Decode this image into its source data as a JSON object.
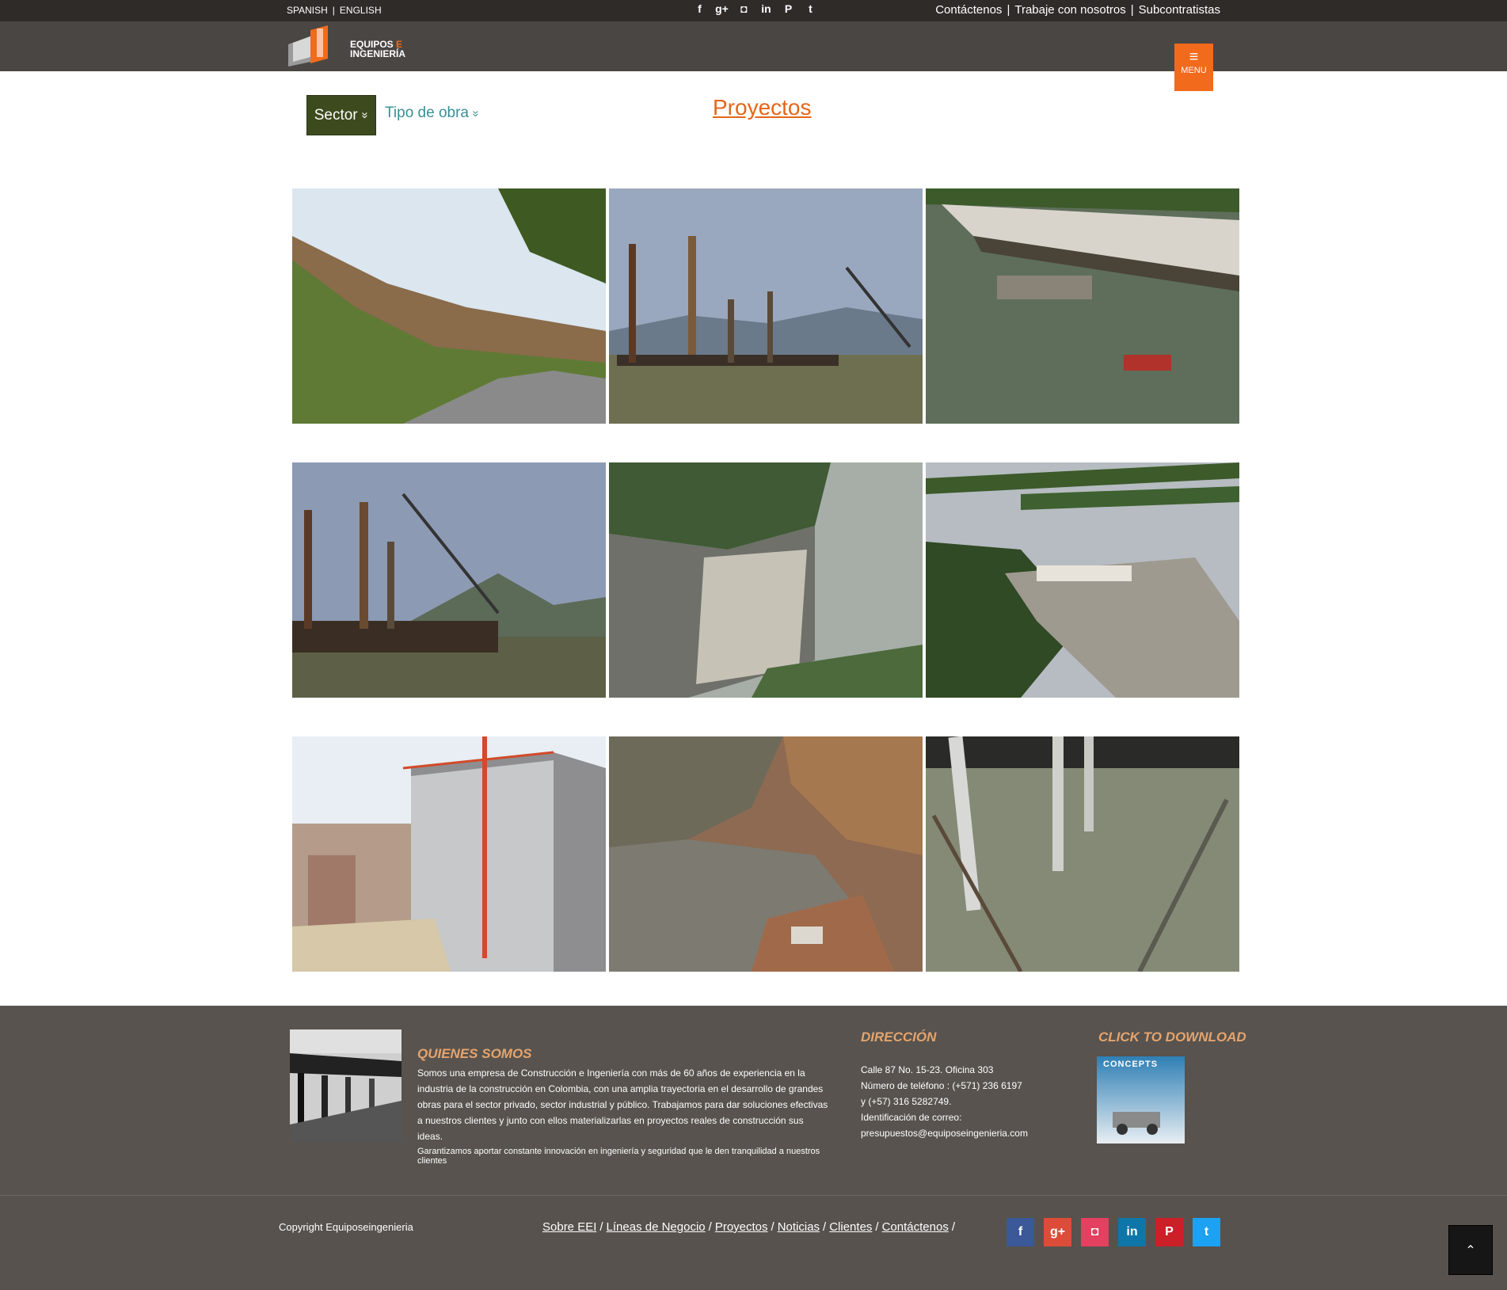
{
  "topbar": {
    "lang_es": "SPANISH",
    "lang_sep": "|",
    "lang_en": "ENGLISH",
    "social": [
      "facebook-icon",
      "google-plus-icon",
      "instagram-icon",
      "linkedin-icon",
      "pinterest-icon",
      "twitter-icon"
    ],
    "social_glyphs": [
      "f",
      "g+",
      "◘",
      "in",
      "P",
      "t"
    ],
    "links": [
      "Contáctenos",
      "Trabaje con nosotros",
      "Subcontratistas"
    ],
    "link_sep": "|"
  },
  "header": {
    "logo_line1": "EQUIPOS",
    "logo_e": "E",
    "logo_line2": "INGENIERÍA",
    "menu_icon": "≡",
    "menu_label": "MENU"
  },
  "filters": {
    "sector": "Sector",
    "tipo": "Tipo de obra",
    "chevron": "»"
  },
  "page_title": "Proyectos",
  "gallery": [
    {
      "name": "highway-hillside"
    },
    {
      "name": "pile-driving-barge"
    },
    {
      "name": "pier-aerial"
    },
    {
      "name": "pier-cranes"
    },
    {
      "name": "aerial-site-river"
    },
    {
      "name": "aerial-port-construction"
    },
    {
      "name": "highrise-construction"
    },
    {
      "name": "rock-slope-works"
    },
    {
      "name": "concrete-slab-pouring"
    }
  ],
  "footer": {
    "about_title": "QUIENES SOMOS",
    "about_text": "Somos una empresa de Construcción e Ingeniería con más de 60 años de experiencia en la industria de la construcción en Colombia, con una amplia trayectoria en el desarrollo de grandes obras para el sector privado, sector industrial y público. Trabajamos para dar soluciones efectivas a nuestros clientes y junto con ellos materializarlas en proyectos reales de construcción sus ideas.",
    "about_text2": "Garantizamos aportar constante innovación en ingeniería y seguridad que le den tranquilidad a nuestros clientes",
    "dir_title": "DIRECCIÓN",
    "dir_lines": [
      "Calle 87 No. 15-23. Oficina 303",
      "Número de teléfono : (+571) 236 6197",
      "y (+57) 316 5282749.",
      "Identificación de correo:",
      "presupuestos@equiposeingenieria.com"
    ],
    "download_title": "CLICK TO DOWNLOAD",
    "download_img_text": "CONCEPTS"
  },
  "bottom": {
    "copyright": "Copyright Equiposeingenieria",
    "nav": [
      "Sobre EEI",
      "Líneas de Negocio",
      "Proyectos",
      "Noticias",
      "Clientes",
      "Contáctenos"
    ],
    "nav_sep": "/",
    "social_colors": [
      "#3b5998",
      "#dd4b39",
      "#e4405f",
      "#0e76a8",
      "#cb2027",
      "#1da1f2"
    ],
    "social_glyphs": [
      "f",
      "g+",
      "◘",
      "in",
      "P",
      "t"
    ],
    "top_btn": "⌃"
  }
}
